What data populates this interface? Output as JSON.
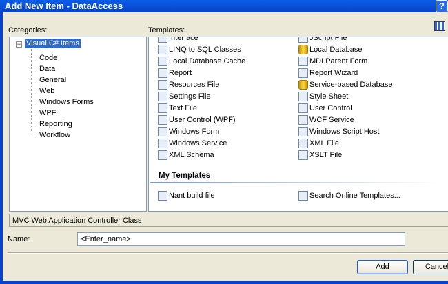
{
  "title": "Add New Item - DataAccess",
  "help": "?",
  "categories_label": "Categories:",
  "templates_label": "Templates:",
  "tree": {
    "root": "Visual C# Items",
    "children": [
      "Code",
      "Data",
      "General",
      "Web",
      "Windows Forms",
      "WPF",
      "Reporting",
      "Workflow"
    ]
  },
  "templates": {
    "left": [
      "Interface",
      "LINQ to SQL Classes",
      "Local Database Cache",
      "Report",
      "Resources File",
      "Settings File",
      "Text File",
      "User Control (WPF)",
      "Windows Form",
      "Windows Service",
      "XML Schema"
    ],
    "right": [
      "JScript File",
      "Local Database",
      "MDI Parent Form",
      "Report Wizard",
      "Service-based Database",
      "Style Sheet",
      "User Control",
      "WCF Service",
      "Windows Script Host",
      "XML File",
      "XSLT File"
    ]
  },
  "my_templates": {
    "heading": "My Templates",
    "items": [
      "Nant build file",
      "Search Online Templates..."
    ]
  },
  "description": "MVC Web Application Controller Class",
  "name_label": "Name:",
  "name_value": "<Enter_name>",
  "buttons": {
    "add": "Add",
    "cancel": "Cancel"
  }
}
